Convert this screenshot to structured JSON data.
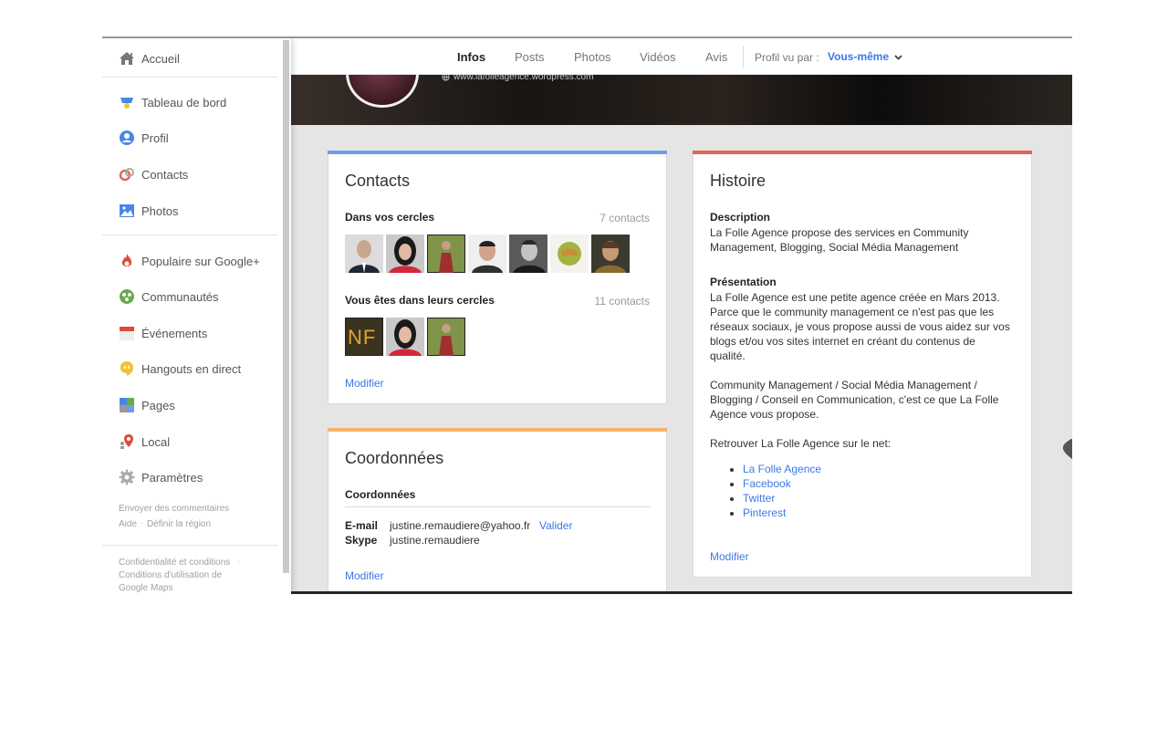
{
  "sidebar": {
    "items": [
      {
        "label": "Accueil",
        "icon": "home-icon"
      },
      {
        "label": "Tableau de bord",
        "icon": "dashboard-icon"
      },
      {
        "label": "Profil",
        "icon": "profile-icon"
      },
      {
        "label": "Contacts",
        "icon": "contacts-icon"
      },
      {
        "label": "Photos",
        "icon": "photos-icon"
      },
      {
        "label": "Populaire sur Google+",
        "icon": "popular-icon"
      },
      {
        "label": "Communautés",
        "icon": "communities-icon"
      },
      {
        "label": "Événements",
        "icon": "events-icon"
      },
      {
        "label": "Hangouts en direct",
        "icon": "hangouts-icon"
      },
      {
        "label": "Pages",
        "icon": "pages-icon"
      },
      {
        "label": "Local",
        "icon": "local-icon"
      },
      {
        "label": "Paramètres",
        "icon": "settings-icon"
      }
    ],
    "feedback": "Envoyer des commentaires",
    "help": "Aide",
    "region": "Définir la région",
    "privacy": "Confidentialité et conditions",
    "maps_terms_1": "Conditions d'utilisation de",
    "maps_terms_2": "Google Maps",
    "separator": "·"
  },
  "tabs": [
    {
      "label": "Infos",
      "active": true
    },
    {
      "label": "Posts",
      "active": false
    },
    {
      "label": "Photos",
      "active": false
    },
    {
      "label": "Vidéos",
      "active": false
    },
    {
      "label": "Avis",
      "active": false
    }
  ],
  "viewed_by": {
    "label": "Profil vu par :",
    "value": "Vous-même",
    "icon": "chevron-down-icon"
  },
  "cover": {
    "url": "www.lafolleagence.wordpress.com",
    "icon": "globe-icon"
  },
  "contacts_card": {
    "title": "Contacts",
    "accent": "#6d9eeb",
    "in_circles_label": "Dans vos cercles",
    "in_circles_count": "7 contacts",
    "in_their_circles_label": "Vous êtes dans leurs cercles",
    "in_their_circles_count": "11 contacts",
    "avatar_text": "NF",
    "edit": "Modifier"
  },
  "coordinates_card": {
    "title": "Coordonnées",
    "accent": "#f6b26b",
    "section": "Coordonnées",
    "email_label": "E-mail",
    "email_value": "justine.remaudiere@yahoo.fr",
    "validate": "Valider",
    "skype_label": "Skype",
    "skype_value": "justine.remaudiere",
    "edit": "Modifier"
  },
  "story_card": {
    "title": "Histoire",
    "accent": "#e06655",
    "description_label": "Description",
    "description_l1": "La Folle Agence propose des services en Community",
    "description_l2": "Management, Blogging, Social Média Management",
    "presentation_label": "Présentation",
    "presentation_l1": "La Folle Agence est une petite agence créée en Mars 2013.",
    "presentation_l2": "Parce que le community management ce n'est pas que les",
    "presentation_l3": "réseaux sociaux, je vous propose aussi de vous aidez sur vos",
    "presentation_l4": "blogs et/ou vos sites internet en créant du contenus de",
    "presentation_l5": "qualité.",
    "services_l1": "Community Management / Social Média Management /",
    "services_l2": "Blogging / Conseil en Communication, c'est ce que La Folle",
    "services_l3": "Agence vous propose.",
    "find_us": "Retrouver La Folle Agence sur le net:",
    "links": [
      "La Folle Agence",
      "Facebook",
      "Twitter",
      "Pinterest"
    ],
    "edit": "Modifier"
  }
}
